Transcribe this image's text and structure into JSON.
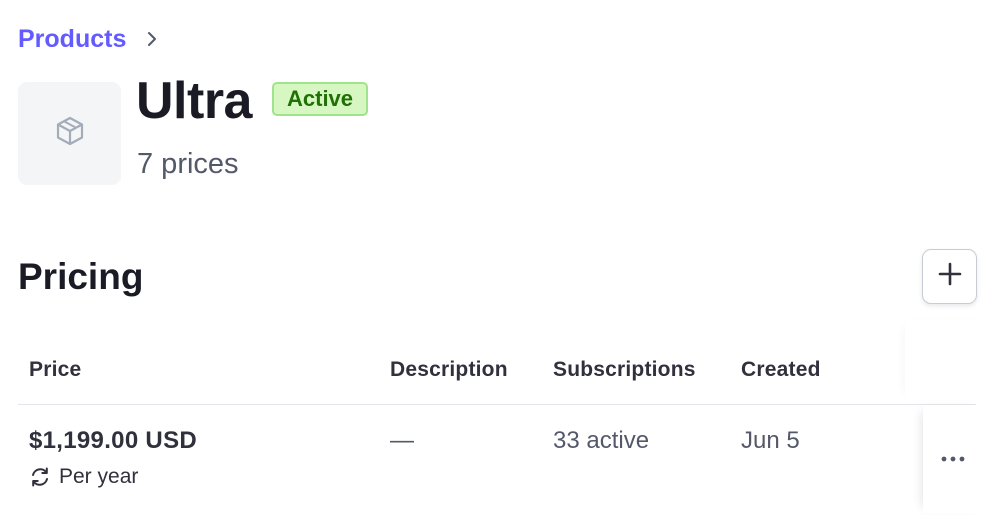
{
  "breadcrumb": {
    "parent_label": "Products",
    "chevron_icon": "chevron-right-icon"
  },
  "product": {
    "icon": "cube-icon",
    "name": "Ultra",
    "status": "Active",
    "prices_count_label": "7 prices"
  },
  "pricing": {
    "section_title": "Pricing",
    "add_icon": "plus-icon",
    "columns": [
      "Price",
      "Description",
      "Subscriptions",
      "Created"
    ],
    "rows": [
      {
        "amount": "$1,199.00 USD",
        "interval_icon": "recurring-icon",
        "interval": "Per year",
        "description": "—",
        "subscriptions": "33 active",
        "created": "Jun 5",
        "menu_icon": "more-horizontal-icon"
      }
    ]
  },
  "colors": {
    "accent": "#635bff",
    "badge_bg": "#d7f7c2",
    "badge_border": "#9fe38a",
    "badge_text": "#217005",
    "text_primary": "#1a1b25",
    "text_secondary": "#545969"
  }
}
